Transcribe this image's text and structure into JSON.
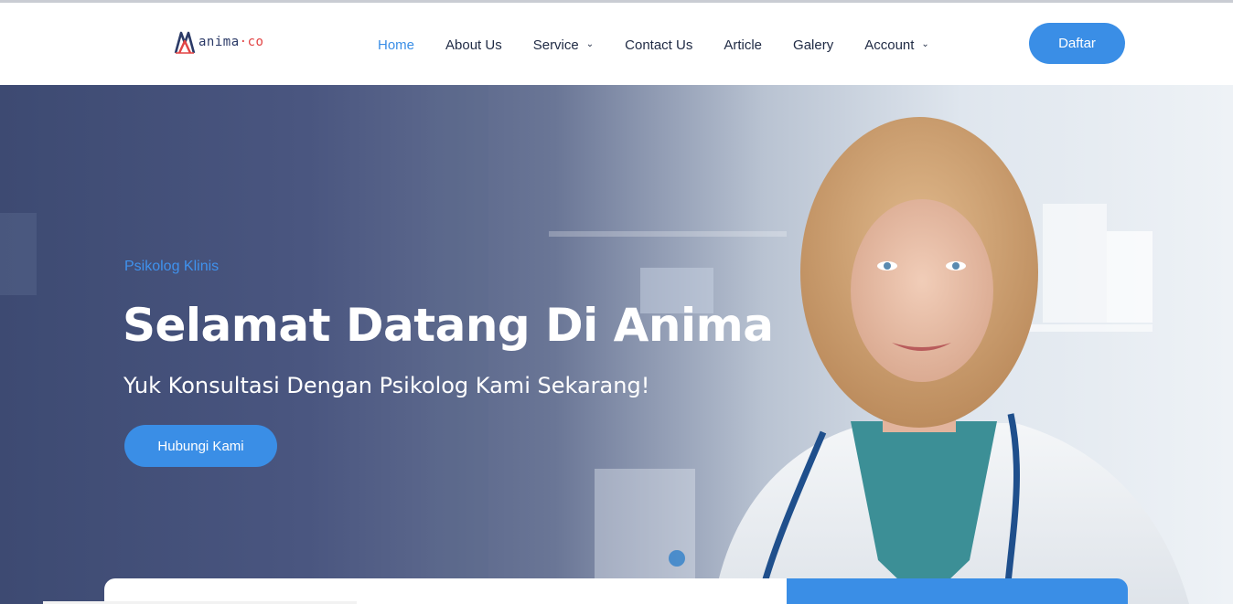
{
  "brand": {
    "logo_text": "anima",
    "logo_dot": "·",
    "logo_suffix": "co"
  },
  "nav": {
    "items": [
      {
        "label": "Home",
        "active": true,
        "dropdown": false
      },
      {
        "label": "About Us",
        "active": false,
        "dropdown": false
      },
      {
        "label": "Service",
        "active": false,
        "dropdown": true
      },
      {
        "label": "Contact Us",
        "active": false,
        "dropdown": false
      },
      {
        "label": "Article",
        "active": false,
        "dropdown": false
      },
      {
        "label": "Galery",
        "active": false,
        "dropdown": false
      },
      {
        "label": "Account",
        "active": false,
        "dropdown": true
      }
    ],
    "cta_label": "Daftar"
  },
  "hero": {
    "tag": "Psikolog Klinis",
    "title": "Selamat Datang Di Anima",
    "subtitle": "Yuk Konsultasi Dengan Psikolog Kami Sekarang!",
    "button_label": "Hubungi Kami"
  },
  "colors": {
    "accent": "#3a8ee6",
    "nav_text": "#1f2a44",
    "hero_overlay": "#3d4a72"
  },
  "icons": {
    "dropdown": "chevron-down-icon",
    "logo": "anima-logo-mark"
  }
}
